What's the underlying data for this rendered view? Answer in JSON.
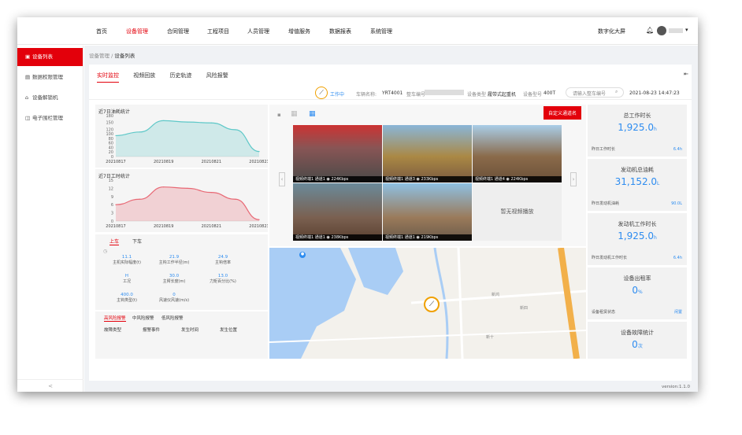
{
  "nav": {
    "items": [
      "首页",
      "设备管理",
      "合同管理",
      "工程项目",
      "人员管理",
      "增值服务",
      "数据报表",
      "系统管理"
    ],
    "active": 1,
    "bigscreen": "数字化大屏"
  },
  "sidebar": {
    "items": [
      "设备列表",
      "数据权限管理",
      "设备解锁机",
      "电子围栏管理"
    ],
    "active": 0,
    "collapse": "<"
  },
  "breadcrumb": {
    "parent": "设备管理",
    "sep": "/",
    "current": "设备列表"
  },
  "tabs": [
    "实时监控",
    "视频回放",
    "历史轨迹",
    "风险报警"
  ],
  "info": {
    "status": "工作中",
    "vehicle_label": "车辆名称:",
    "vehicle": "YRT4001",
    "code_label": "整车编号",
    "type_label": "设备类型",
    "type": "履带式起重机",
    "model_label": "设备型号",
    "model": "400T",
    "search_placeholder": "请输入整车编号",
    "datetime": "2021-08-23 14:47:23"
  },
  "chart_data": [
    {
      "type": "area",
      "title": "近7日油耗统计",
      "x": [
        "20210817",
        "20210818",
        "20210819",
        "20210820",
        "20210821",
        "20210822",
        "20210823"
      ],
      "yticks": [
        0,
        20,
        40,
        60,
        80,
        100,
        120,
        150,
        180
      ],
      "ylim": [
        0,
        180
      ],
      "values": [
        92,
        108,
        158,
        152,
        148,
        118,
        22
      ],
      "color": "#5ec8c8"
    },
    {
      "type": "area",
      "title": "近7日工时统计",
      "x": [
        "20210817",
        "20210818",
        "20210819",
        "20210820",
        "20210821",
        "20210822",
        "20210823"
      ],
      "yticks": [
        0,
        3,
        6,
        9,
        12,
        15
      ],
      "ylim": [
        0,
        15
      ],
      "values": [
        6,
        8,
        12.5,
        12,
        10.5,
        8,
        0.5
      ],
      "color": "#e86874"
    }
  ],
  "gauge_tabs": [
    "上车",
    "下车"
  ],
  "gauges": [
    {
      "value": "11.1",
      "label": "主机实际幅度(t)"
    },
    {
      "value": "21.9",
      "label": "主钩工作半径(m)"
    },
    {
      "value": "24.9",
      "label": "主钩倍率"
    },
    {
      "value": "H",
      "label": "工况"
    },
    {
      "value": "30.0",
      "label": "主臂长度(m)"
    },
    {
      "value": "13.0",
      "label": "力矩百分比(%)"
    },
    {
      "value": "400.0",
      "label": "主钩类型(t)"
    },
    {
      "value": "0",
      "label": "风速仪风速(m/s)"
    }
  ],
  "alarm_tabs": [
    "高风险报警",
    "中风险报警",
    "低风险报警"
  ],
  "alarm_cols": [
    "故障类型",
    "报警事件",
    "发生时间",
    "发生位置"
  ],
  "custom_channel": "自定义通道名",
  "videos": [
    {
      "label": "视频终端1 通道1 ◉ 224Kbps"
    },
    {
      "label": "视频终端1 通道3 ◉ 233Kbps"
    },
    {
      "label": "视频终端1 通道4 ◉ 224Kbps"
    },
    {
      "label": "视频终端1 通道1 ◉ 238Kbps"
    },
    {
      "label": "视频终端1 通道1 ◉ 219Kbps"
    }
  ],
  "no_video": "暂无视频播放",
  "map_labels": [
    "新鸿",
    "新四",
    "新十"
  ],
  "stats": [
    {
      "title": "总工作时长",
      "value": "1,925.0",
      "unit": "h",
      "foot": "昨日工作时长",
      "foot_val": "6.4h"
    },
    {
      "title": "发动机总油耗",
      "value": "31,152.0",
      "unit": "L",
      "foot": "昨日发动机油耗",
      "foot_val": "90.0L"
    },
    {
      "title": "发动机工作时长",
      "value": "1,925.0",
      "unit": "h",
      "foot": "昨日发动机工作时长",
      "foot_val": "6.4h"
    },
    {
      "title": "设备出租率",
      "value": "0",
      "unit": "%",
      "foot": "设备租赁状态",
      "foot_val": "闲置"
    },
    {
      "title": "设备故障统计",
      "value": "0",
      "unit": "次",
      "foot": "",
      "foot_val": ""
    }
  ],
  "version": "version:1.1.0",
  "colors": {
    "accent": "#e3000b",
    "blue": "#2d8cf0"
  }
}
